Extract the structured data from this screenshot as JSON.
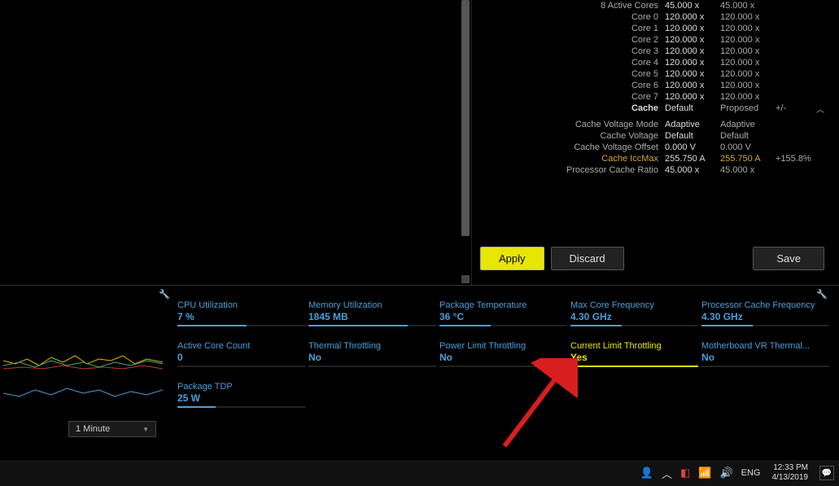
{
  "cores_header": {
    "label": "8 Active Cores",
    "v1": "45.000 x",
    "v2": "45.000 x"
  },
  "cores": [
    {
      "label": "Core 0",
      "v1": "120.000 x",
      "v2": "120.000 x"
    },
    {
      "label": "Core 1",
      "v1": "120.000 x",
      "v2": "120.000 x"
    },
    {
      "label": "Core 2",
      "v1": "120.000 x",
      "v2": "120.000 x"
    },
    {
      "label": "Core 3",
      "v1": "120.000 x",
      "v2": "120.000 x"
    },
    {
      "label": "Core 4",
      "v1": "120.000 x",
      "v2": "120.000 x"
    },
    {
      "label": "Core 5",
      "v1": "120.000 x",
      "v2": "120.000 x"
    },
    {
      "label": "Core 6",
      "v1": "120.000 x",
      "v2": "120.000 x"
    },
    {
      "label": "Core 7",
      "v1": "120.000 x",
      "v2": "120.000 x"
    }
  ],
  "cache_header": {
    "label": "Cache",
    "v1": "Default",
    "v2": "Proposed",
    "v3": "+/-"
  },
  "cache_rows": [
    {
      "label": "Cache Voltage Mode",
      "v1": "Adaptive",
      "v2": "Adaptive",
      "v3": ""
    },
    {
      "label": "Cache Voltage",
      "v1": "Default",
      "v2": "Default",
      "v3": ""
    },
    {
      "label": "Cache Voltage Offset",
      "v1": "0.000 V",
      "v2": "0.000 V",
      "v3": ""
    },
    {
      "label": "Cache IccMax",
      "v1": "255.750 A",
      "v2": "255.750 A",
      "v3": "+155.8%",
      "highlight": true
    },
    {
      "label": "Processor Cache Ratio",
      "v1": "45.000 x",
      "v2": "45.000 x",
      "v3": ""
    }
  ],
  "buttons": {
    "apply": "Apply",
    "discard": "Discard",
    "save": "Save"
  },
  "time_selector": "1 Minute",
  "stats": [
    {
      "label": "CPU Utilization",
      "value": "7 %",
      "fill": 54
    },
    {
      "label": "Memory Utilization",
      "value": "1845  MB",
      "fill": 78
    },
    {
      "label": "Package Temperature",
      "value": "36 °C",
      "fill": 40
    },
    {
      "label": "Max Core Frequency",
      "value": "4.30 GHz",
      "fill": 40
    },
    {
      "label": "Processor Cache Frequency",
      "value": "4.30 GHz",
      "fill": 40
    },
    {
      "label": "Active Core Count",
      "value": "0",
      "fill": 0
    },
    {
      "label": "Thermal Throttling",
      "value": "No",
      "fill": 0
    },
    {
      "label": "Power Limit Throttling",
      "value": "No",
      "fill": 0
    },
    {
      "label": "Current Limit Throttling",
      "value": "Yes",
      "fill": 100,
      "highlight": true
    },
    {
      "label": "Motherboard VR Thermal...",
      "value": "No",
      "fill": 0
    },
    {
      "label": "Package TDP",
      "value": "25 W",
      "fill": 30
    }
  ],
  "taskbar": {
    "lang": "ENG",
    "time": "12:33 PM",
    "date": "4/13/2019"
  }
}
